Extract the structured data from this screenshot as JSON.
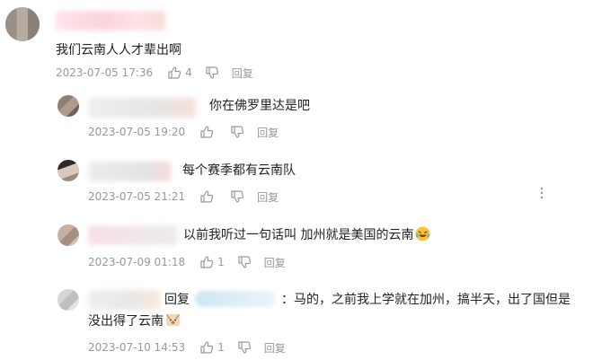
{
  "comments": [
    {
      "text": "我们云南人人才辈出啊",
      "time": "2023-07-05 17:36",
      "likes": "4",
      "reply_label": "回复"
    }
  ],
  "replies": [
    {
      "text": "你在佛罗里达是吧",
      "time": "2023-07-05 19:20",
      "likes": "",
      "reply_label": "回复"
    },
    {
      "text": "每个赛季都有云南队",
      "time": "2023-07-05 21:21",
      "likes": "",
      "reply_label": "回复"
    },
    {
      "text": "以前我听过一句话叫 加州就是美国的云南",
      "emoji": "laughing-emoji",
      "time": "2023-07-09 01:18",
      "likes": "1",
      "reply_label": "回复"
    },
    {
      "reply_prefix": "回复",
      "text_line1": "：马的，之前我上学就在加州，搞半天，出了国但是",
      "text_line2": "没出得了云南",
      "emoji": "dog-emoji",
      "time": "2023-07-10 14:53",
      "likes": "1",
      "reply_label": "回复"
    }
  ],
  "icons": {
    "like": "thumb-up-icon",
    "dislike": "thumb-down-icon",
    "more": "more-vertical-icon"
  },
  "colors": {
    "meta": "#9499a0",
    "text": "#222222"
  }
}
